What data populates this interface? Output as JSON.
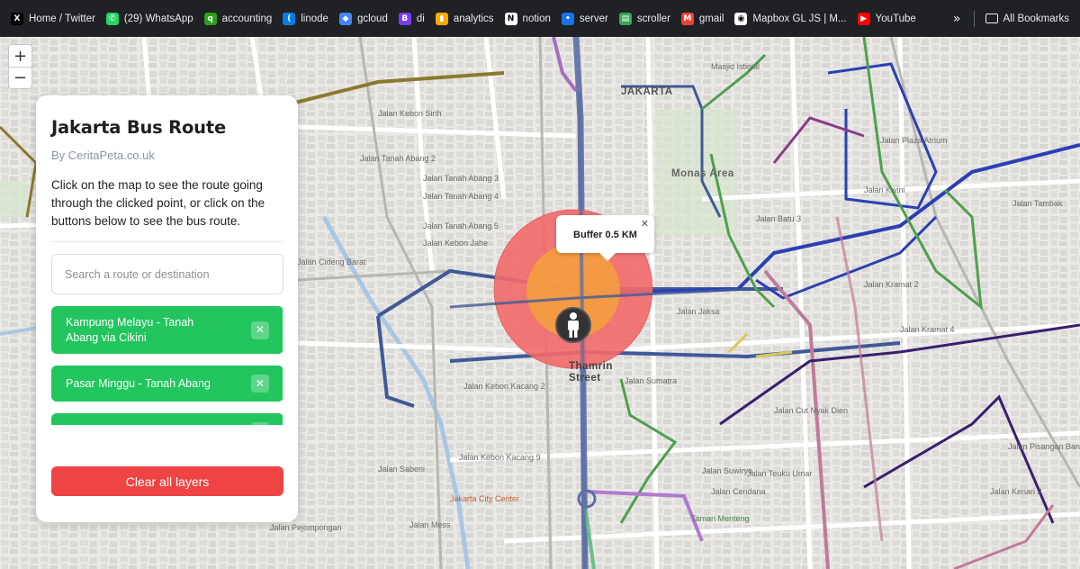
{
  "bookmarks": [
    {
      "label": "Home / Twitter",
      "icon": "x-logo-icon",
      "color": "#000000",
      "glyph": "X"
    },
    {
      "label": "(29) WhatsApp",
      "icon": "whatsapp-icon",
      "color": "#25d366",
      "glyph": "✆"
    },
    {
      "label": "accounting",
      "icon": "accounting-icon",
      "color": "#2ca01c",
      "glyph": "q"
    },
    {
      "label": "linode",
      "icon": "linode-icon",
      "color": "#0b7de0",
      "glyph": "("
    },
    {
      "label": "gcloud",
      "icon": "gcloud-icon",
      "color": "#4285f4",
      "glyph": "◆"
    },
    {
      "label": "di",
      "icon": "di-icon",
      "color": "#7c3aed",
      "glyph": "B"
    },
    {
      "label": "analytics",
      "icon": "analytics-icon",
      "color": "#f9ab00",
      "glyph": "▮"
    },
    {
      "label": "notion",
      "icon": "notion-icon",
      "color": "#ffffff",
      "glyph": "N"
    },
    {
      "label": "server",
      "icon": "server-icon",
      "color": "#1a73e8",
      "glyph": "•"
    },
    {
      "label": "scroller",
      "icon": "scroller-icon",
      "color": "#34a853",
      "glyph": "▤"
    },
    {
      "label": "gmail",
      "icon": "gmail-icon",
      "color": "#ea4335",
      "glyph": "M"
    },
    {
      "label": "Mapbox GL JS | M...",
      "icon": "mapbox-icon",
      "color": "#ffffff",
      "glyph": "◉"
    },
    {
      "label": "YouTube",
      "icon": "youtube-icon",
      "color": "#ff0000",
      "glyph": "▶"
    }
  ],
  "bookmarks_more": "»",
  "all_bookmarks": "All Bookmarks",
  "zoom": {
    "in": "+",
    "out": "−"
  },
  "panel": {
    "title": "Jakarta Bus Route",
    "author": "By CeritaPeta.co.uk",
    "description": "Click on the map to see the route going through the clicked point, or click on the buttons below to see the bus route.",
    "search_placeholder": "Search a route or destination",
    "routes": [
      {
        "label": "Kampung Melayu - Tanah Abang via Cikini"
      },
      {
        "label": "Pasar Minggu - Tanah Abang"
      },
      {
        "label": ""
      }
    ],
    "remove_glyph": "✕",
    "clear_label": "Clear all layers",
    "route_color": "#22c55e",
    "clear_color": "#ef4444"
  },
  "popup": {
    "text": "Buffer 0.5 KM",
    "close": "✕"
  },
  "buffer": {
    "radius_km": 0.5,
    "outer_color": "#f05a5a",
    "inner_color": "#f5a03c"
  },
  "map_labels": {
    "area": [
      "JAKARTA",
      "Monas Area",
      "Thamrin Street"
    ],
    "streets": [
      "Jalan Tanah Abang 3",
      "Jalan Tanah Abang 4",
      "Jalan Tanah Abang 5",
      "Jalan Tanah Abang 2",
      "Jalan Kebon Jahe",
      "Jalan Kebon Kacang 2",
      "Jalan Kebon Kacang 9",
      "Jalan Cideng Barat",
      "Jalan Batu 3",
      "Jalan Sumatra",
      "Jalan Jaksa",
      "Jalan Kwini",
      "Jalan Kramat 2",
      "Jalan Kramat 4",
      "Jalan Cut Nyak Dien",
      "Jalan Teuku Umar",
      "Jalan Cendana",
      "Jalan Suwiryo",
      "Jalan Sabeni",
      "Jalan Mess",
      "Jalan Pejompongan",
      "Jalan Kebon Sirih",
      "Jalan Pisangan Baru",
      "Jalan Tambak",
      "Jalan Kenari 2",
      "Jalan Plaza Atrium",
      "Jakarta City Center",
      "Masjid Istiqlal",
      "Taman Menteng"
    ]
  }
}
